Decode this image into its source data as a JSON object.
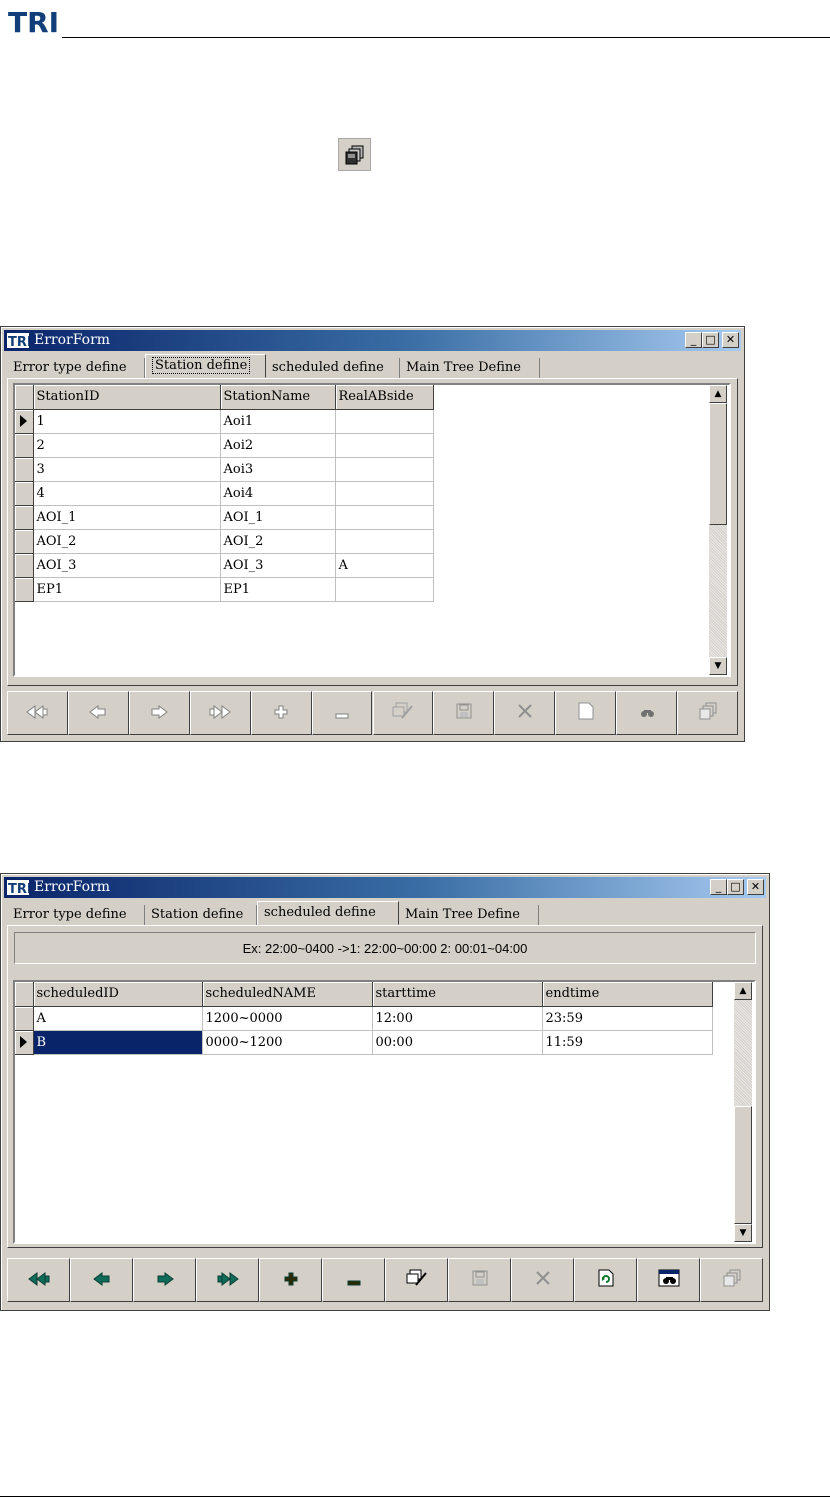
{
  "header": {
    "logo_text": "TRI"
  },
  "window1": {
    "title": "ErrorForm",
    "tabs": [
      "Error type define",
      "Station define",
      "scheduled define",
      "Main Tree Define"
    ],
    "active_tab": "Station define",
    "columns": [
      "StationID",
      "StationName",
      "RealABside"
    ],
    "rows": [
      [
        "1",
        "Aoi1",
        ""
      ],
      [
        "2",
        "Aoi2",
        ""
      ],
      [
        "3",
        "Aoi3",
        ""
      ],
      [
        "4",
        "Aoi4",
        ""
      ],
      [
        "AOI_1",
        "AOI_1",
        ""
      ],
      [
        "AOI_2",
        "AOI_2",
        ""
      ],
      [
        "AOI_3",
        "AOI_3",
        "A"
      ],
      [
        "EP1",
        "EP1",
        ""
      ]
    ],
    "current_row": 0,
    "navigator_enabled": false
  },
  "window2": {
    "title": "ErrorForm",
    "tabs": [
      "Error type define",
      "Station define",
      "scheduled define",
      "Main Tree Define"
    ],
    "active_tab": "scheduled define",
    "hint": "Ex: 22:00~0400 ->1:  22:00~00:00  2: 00:01~04:00",
    "columns": [
      "scheduledID",
      "scheduledNAME",
      "starttime",
      "endtime"
    ],
    "rows": [
      [
        "A",
        "1200~0000",
        "12:00",
        "23:59"
      ],
      [
        "B",
        "0000~1200",
        "00:00",
        "11:59"
      ]
    ],
    "current_row": 1,
    "navigator_enabled": true
  },
  "navigator_buttons": [
    "first-icon",
    "prior-icon",
    "next-icon",
    "last-icon",
    "insert-icon",
    "delete-icon",
    "edit-icon",
    "post-icon",
    "cancel-icon",
    "refresh-icon",
    "find-icon",
    "copy-icon"
  ],
  "colors": {
    "title_start": "#0a246a",
    "title_end": "#a6caf0",
    "nav_active": "#0f6b5a",
    "face": "#d4d0c8"
  }
}
